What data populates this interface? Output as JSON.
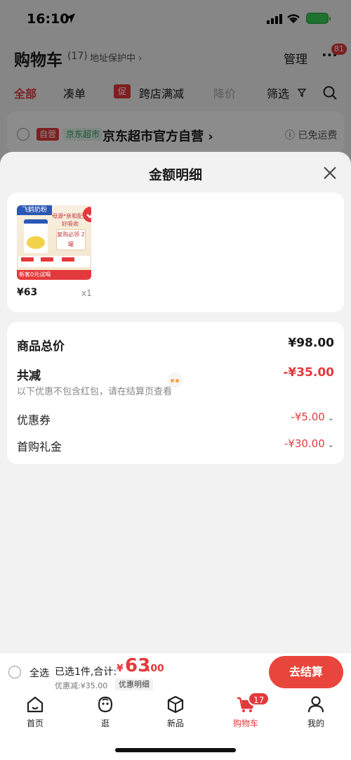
{
  "status_bar": {
    "time": "16:10"
  },
  "header": {
    "title": "购物车",
    "count": "(17)",
    "address_protect": "地址保护中 ›",
    "manage": "管理",
    "more_badge": "81"
  },
  "filters": {
    "all": "全部",
    "coudan": "凑单",
    "promo_badge": "促",
    "cross_store": "跨店满减",
    "price_drop": "降价",
    "filter": "筛选"
  },
  "shop": {
    "self_badge": "自营",
    "jd_badge": "京东超市",
    "name": "京东超市官方自营 ›",
    "free_shipping": "已免运费"
  },
  "sheet": {
    "title": "金额明细",
    "product": {
      "brand": "飞鹤奶粉",
      "promo_line": "母源*亲和配方 好吸收",
      "promo_box": "复购必领 2罐",
      "bottom_bar": "新客0元试喝",
      "price": "¥63",
      "qty": "x1"
    },
    "breakdown": {
      "total_label": "商品总价",
      "total_value": "¥98.00",
      "reduce_label": "共减",
      "reduce_value": "-¥35.00",
      "note": "以下优惠不包含红包，请在结算页查看",
      "coupon_label": "优惠券",
      "coupon_value": "-¥5.00",
      "first_buy_label": "首购礼金",
      "first_buy_value": "-¥30.00"
    }
  },
  "settle": {
    "select_all": "全选",
    "selected_total": "已选1件,合计:",
    "currency": "¥",
    "price_int": "63",
    "price_dec": ".00",
    "discount_note": "优惠减:¥35.00",
    "detail_link": "优惠明细",
    "checkout": "去结算"
  },
  "tabbar": {
    "home": "首页",
    "stroll": "逛",
    "new": "新品",
    "cart": "购物车",
    "cart_badge": "17",
    "me": "我的"
  },
  "colors": {
    "accent": "#e4393c",
    "checkout": "#e8463c"
  }
}
